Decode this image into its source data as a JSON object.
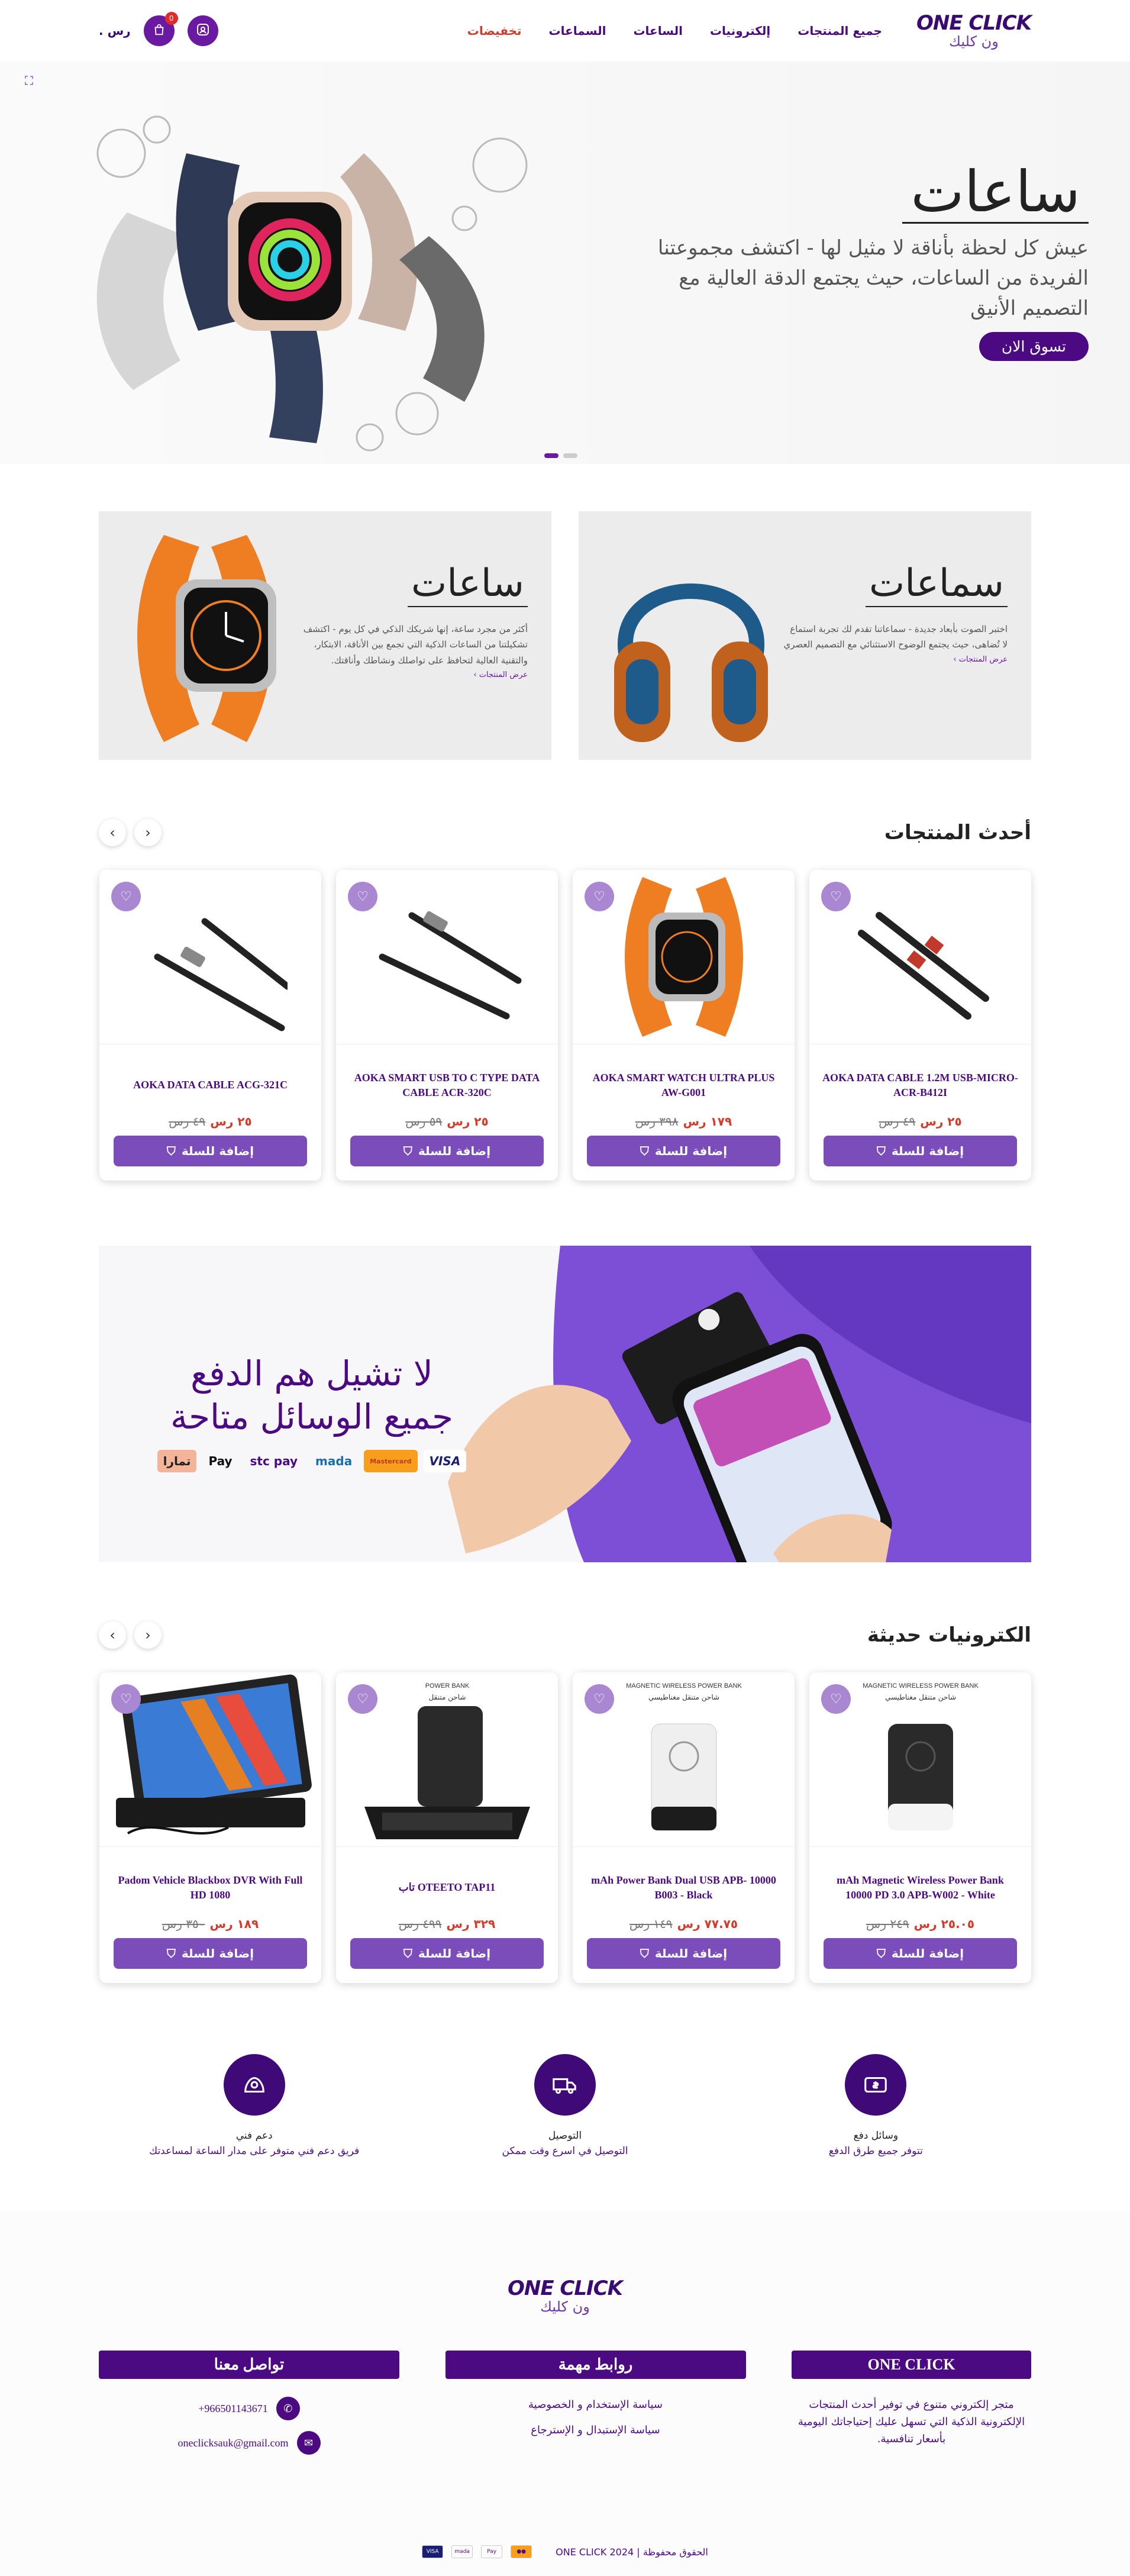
{
  "header": {
    "logo_top": "ONE CLICK",
    "logo_bottom": "ون كليك",
    "nav": [
      "جميع المنتجات",
      "إلكترونيات",
      "الساعات",
      "السماعات",
      "تخفيضات"
    ],
    "currency": ". رس",
    "cart_count": "0"
  },
  "hero": {
    "title": "ساعات",
    "subtitle": "عيش كل لحظة بأناقة لا مثيل لها - اكتشف مجموعتنا الفريدة من الساعات، حيث يجتمع الدقة العالية مع التصميم الأنيق",
    "button": "تسوق الان"
  },
  "promos": [
    {
      "title": "سماعات",
      "desc": "اختبر الصوت بأبعاد جديدة - سماعاتنا تقدم لك تجربة استماع لا تُضاهى، حيث يجتمع الوضوح الاستثنائي مع التصميم العصري",
      "link": "عرض المنتجات ›"
    },
    {
      "title": "ساعات",
      "desc": "أكثر من مجرد ساعة، إنها شريكك الذكي في كل يوم - اكتشف تشكيلتنا من الساعات الذكية التي تجمع بين الأناقة، الابتكار، والتقنية العالية لتحافظ على تواصلك ونشاطك وأناقتك.",
      "link": "عرض المنتجات ›"
    }
  ],
  "latest": {
    "title": "أحدث المنتجات",
    "products": [
      {
        "name": "AOKA DATA CABLE 1.2M USB-MICRO-ACR-B412I",
        "price": "٢٥ رس",
        "old": "٤٩ رس"
      },
      {
        "name": "AOKA SMART WATCH ULTRA PLUS AW-G001",
        "price": "١٧٩ رس",
        "old": "٣٩٨ رس"
      },
      {
        "name": "AOKA SMART USB TO C TYPE DATA CABLE ACR-320C",
        "price": "٢٥ رس",
        "old": "٥٩ رس"
      },
      {
        "name": "AOKA DATA CABLE ACG-321C",
        "price": "٢٥ رس",
        "old": "٤٩ رس"
      }
    ],
    "add_label": "إضافة للسلة"
  },
  "payment": {
    "line1": "لا تشيل هم الدفع",
    "line2": "جميع الوسائل متاحة",
    "logos": [
      "تمارا",
      "Pay",
      "stc pay",
      "mada",
      "Mastercard",
      "VISA"
    ]
  },
  "electronics": {
    "title": "الكترونيات حديثة",
    "products": [
      {
        "name": "mAh Magnetic Wireless Power Bank 10000 PD 3.0 APB-W002 - White",
        "price": "٢٥.٠٥ رس",
        "old": "٢٤٩ رس",
        "img_top": "MAGNETIC WIRELESS POWER BANK",
        "img_ar": "شاحن متنقل مغناطيسي"
      },
      {
        "name": "mAh Power Bank Dual USB APB- 10000 B003 - Black",
        "price": "٧٧.٧٥ رس",
        "old": "١٤٩ رس",
        "img_top": "MAGNETIC WIRELESS POWER BANK",
        "img_ar": "شاحن متنقل مغناطيسي"
      },
      {
        "name": "OTEETO TAP11 تاب",
        "price": "٣٢٩ رس",
        "old": "٤٩٩ رس",
        "img_top": "POWER BANK",
        "img_ar": "شاحن متنقل"
      },
      {
        "name": "Padom Vehicle Blackbox DVR With Full HD 1080",
        "price": "١٨٩ رس",
        "old": "٣٥٠ رس"
      }
    ]
  },
  "features": [
    {
      "title": "وسائل دفع",
      "desc": "تتوفر جميع طرق الدفع"
    },
    {
      "title": "التوصيل",
      "desc": "التوصيل في اسرع وقت ممكن"
    },
    {
      "title": "دعم فني",
      "desc": "فريق دعم فني متوفر على مدار الساعة لمساعدتك"
    }
  ],
  "footer": {
    "col1_title": "ONE CLICK",
    "col1_text": "متجر إلكتروني متنوع في توفير أحدث المنتجات الإلكترونية الذكية التي تسهل عليك إحتياجاتك اليومية بأسعار تنافسية.",
    "col2_title": "روابط مهمة",
    "col2_links": [
      "سياسة الإستخدام و الخصوصية",
      "سياسة الإستبدال و الإسترجاع"
    ],
    "col3_title": "تواصل معنا",
    "phone": "+966501143671",
    "email": "oneclicksauk@gmail.com",
    "copyright": "الحقوق محفوظة | ONE CLICK 2024"
  },
  "colors": {
    "brand": "#4b0a82",
    "accent": "#7b4dba",
    "sale": "#d43b2a"
  }
}
